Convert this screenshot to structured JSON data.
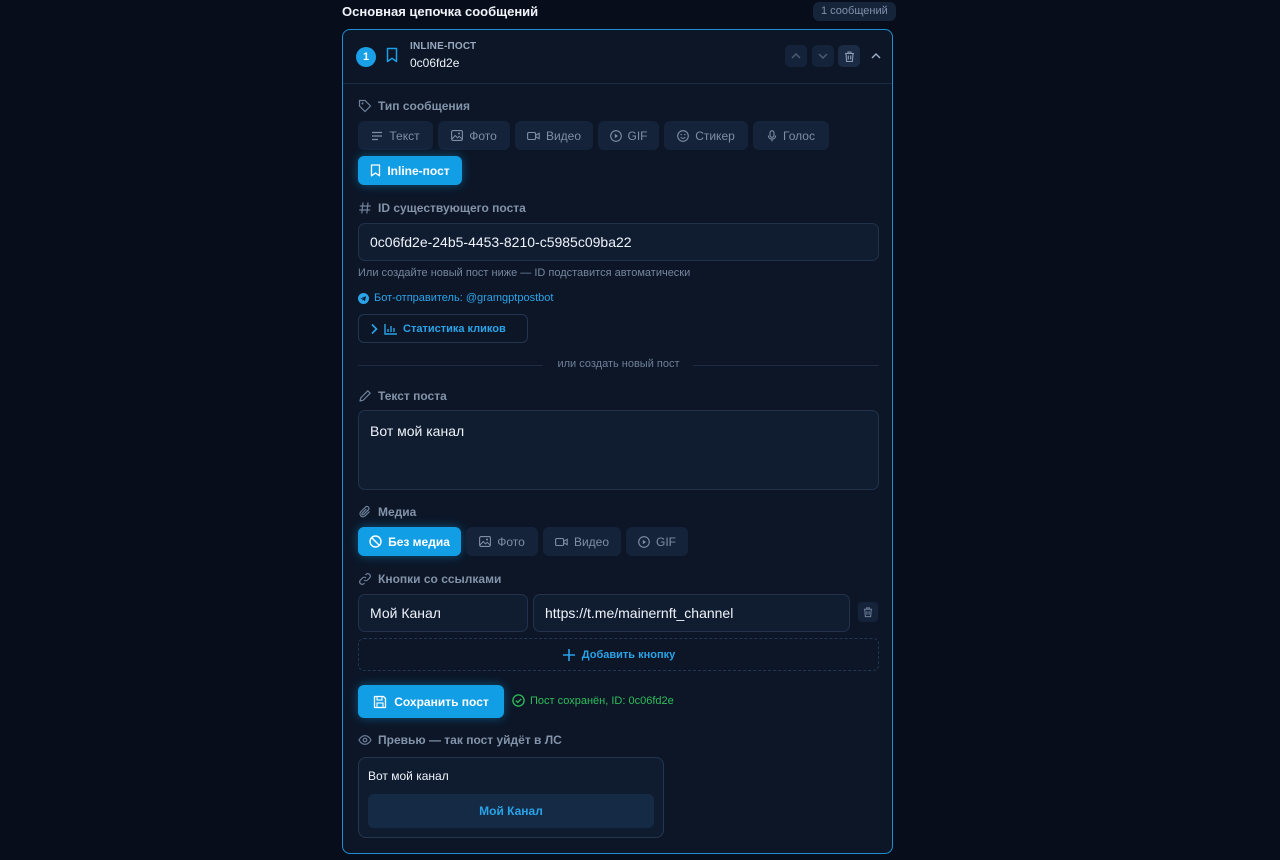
{
  "header": {
    "title": "Основная цепочка сообщений",
    "badge": "1 сообщений"
  },
  "card": {
    "number": "1",
    "type_label": "INLINE-ПОСТ",
    "id_short": "0c06fd2e",
    "icons": [
      "bookmark-icon",
      "chevron-up-icon",
      "chevron-down-icon",
      "trash-icon",
      "collapse-chevron-icon"
    ]
  },
  "message_type": {
    "label": "Тип сообщения",
    "options": [
      "Текст",
      "Фото",
      "Видео",
      "GIF",
      "Стикер",
      "Голос",
      "Inline-пост"
    ],
    "selected": "Inline-пост"
  },
  "post_id": {
    "label": "ID существующего поста",
    "value": "0c06fd2e-24b5-4453-8210-c5985c09ba22",
    "hint": "Или создайте новый пост ниже — ID подставится автоматически"
  },
  "bot": {
    "text": "Бот-отправитель: @gramgptpostbot"
  },
  "stats_button": "Статистика кликов",
  "divider": "или создать новый пост",
  "post_text": {
    "label": "Текст поста",
    "value": "Вот мой канал"
  },
  "media": {
    "label": "Медиа",
    "options": [
      "Без медиа",
      "Фото",
      "Видео",
      "GIF"
    ],
    "selected": "Без медиа"
  },
  "link_buttons": {
    "label": "Кнопки со ссылками",
    "rows": [
      {
        "text": "Мой Канал",
        "url": "https://t.me/mainernft_channel"
      }
    ],
    "add_label": "Добавить кнопку"
  },
  "save": {
    "label": "Сохранить пост",
    "status": "Пост сохранён, ID: 0c06fd2e"
  },
  "preview": {
    "label": "Превью — так пост уйдёт в ЛС",
    "text": "Вот мой канал",
    "button": "Мой Канал"
  },
  "colors": {
    "accent": "#129ee4",
    "success": "#2fbf5a",
    "background": "#070d1a",
    "card": "#0c1627"
  }
}
